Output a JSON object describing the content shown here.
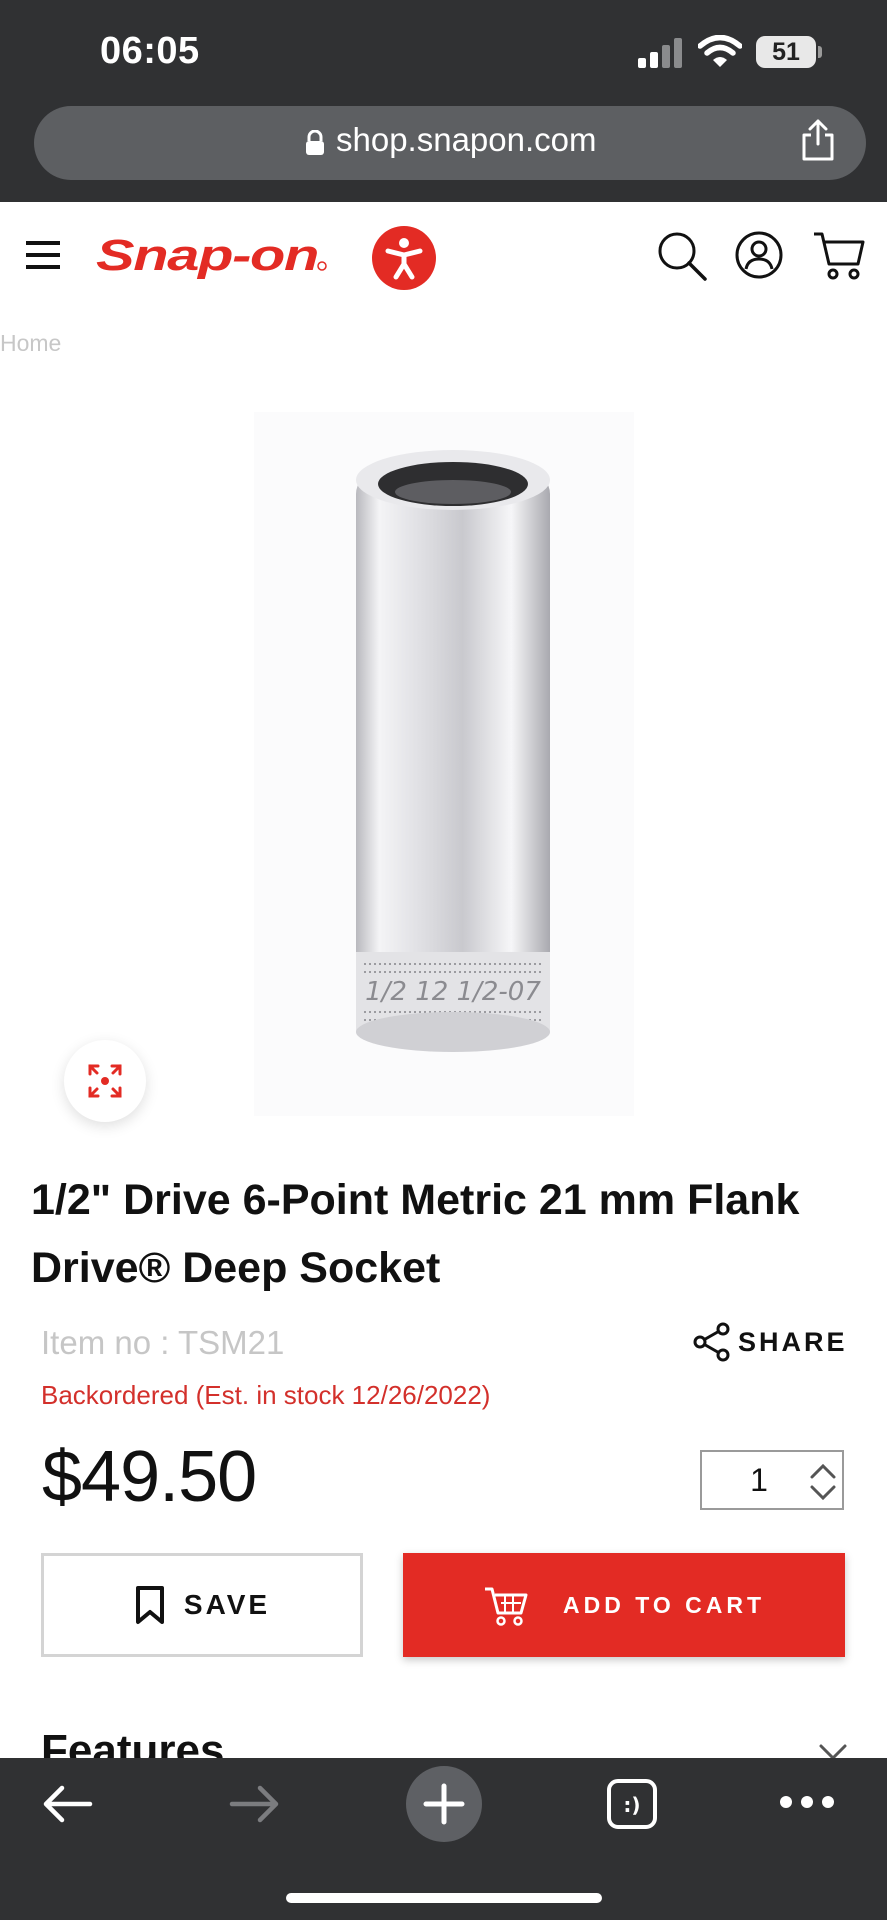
{
  "status_bar": {
    "time": "06:05",
    "battery": "51"
  },
  "browser": {
    "url": "shop.snapon.com"
  },
  "header": {
    "logo_text": "Snap-on"
  },
  "breadcrumb": {
    "home": "Home"
  },
  "product": {
    "title": "1/2\" Drive 6-Point Metric 21 mm Flank Drive® Deep Socket",
    "item_no": "Item no : TSM21",
    "stock_status": "Backordered (Est. in stock 12/26/2022)",
    "price": "$49.50",
    "quantity": "1",
    "share_label": "SHARE",
    "save_label": "SAVE",
    "add_to_cart_label": "ADD TO CART"
  },
  "sections": {
    "features_heading": "Features"
  },
  "colors": {
    "brand_red": "#e32b24",
    "stock_red": "#d3302b",
    "browser_chrome": "#303133"
  },
  "icons": [
    "menu-icon",
    "accessibility-icon",
    "search-icon",
    "account-icon",
    "cart-icon",
    "expand-icon",
    "share-icon",
    "bookmark-icon",
    "cart-icon",
    "chevron-down-icon",
    "back-arrow-icon",
    "forward-arrow-icon",
    "plus-icon",
    "tabs-icon",
    "more-icon"
  ]
}
